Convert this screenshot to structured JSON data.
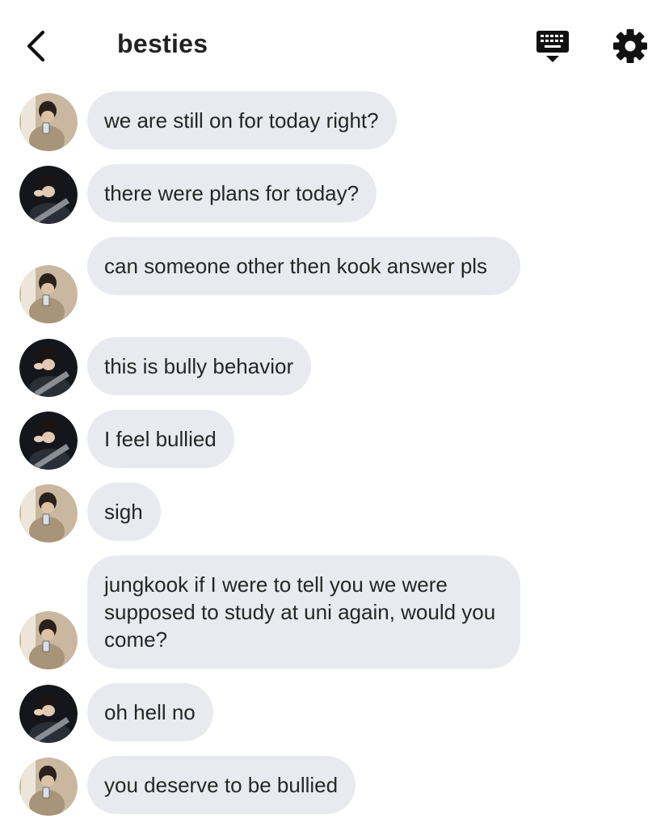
{
  "header": {
    "title": "besties",
    "back_icon": "chevron-left-icon",
    "keyboard_icon": "keyboard-icon",
    "settings_icon": "gear-icon"
  },
  "colors": {
    "bubble": "#e8eaef",
    "text": "#222222",
    "background": "#ffffff"
  },
  "messages": [
    {
      "sender": "light",
      "text": "we are still on for today right?"
    },
    {
      "sender": "dark",
      "text": "there were plans for today?"
    },
    {
      "sender": "light",
      "text": "can someone other then kook answer pls"
    },
    {
      "sender": "dark",
      "text": "this is bully behavior"
    },
    {
      "sender": "dark",
      "text": "I feel bullied"
    },
    {
      "sender": "light",
      "text": "sigh"
    },
    {
      "sender": "light",
      "text": "jungkook if I were to tell you we were supposed to study at uni again, would you come?"
    },
    {
      "sender": "dark",
      "text": "oh hell no"
    },
    {
      "sender": "light",
      "text": "you deserve to be bullied"
    }
  ]
}
